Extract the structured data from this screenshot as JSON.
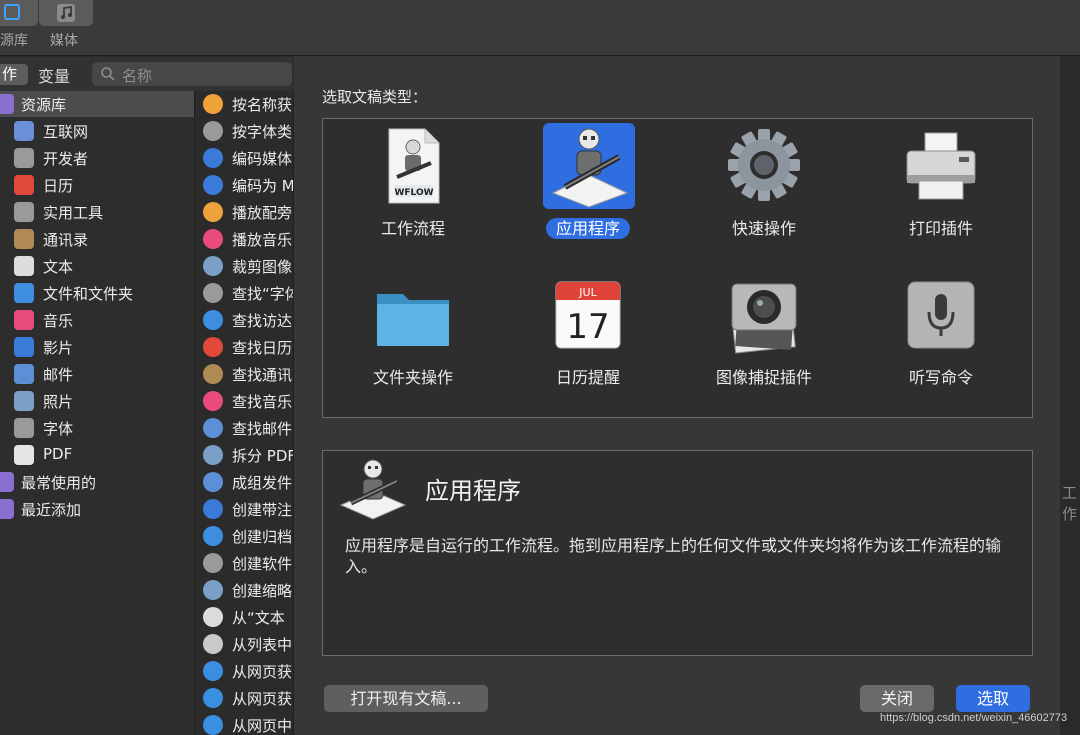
{
  "toolbar": {
    "library_label_fragment": "源库",
    "media_label": "媒体"
  },
  "tabs": {
    "actions_fragment": "作",
    "variables": "变量"
  },
  "search": {
    "placeholder": "名称"
  },
  "library": {
    "items": [
      {
        "label": "资源库",
        "icon": "library-icon",
        "color": "#8a6fd1"
      },
      {
        "label": "互联网",
        "icon": "internet-icon",
        "color": "#6b8fd8"
      },
      {
        "label": "开发者",
        "icon": "developer-tools-icon",
        "color": "#9a9a9a"
      },
      {
        "label": "日历",
        "icon": "calendar-icon",
        "color": "#e14a3b"
      },
      {
        "label": "实用工具",
        "icon": "utilities-icon",
        "color": "#9a9a9a"
      },
      {
        "label": "通讯录",
        "icon": "contacts-icon",
        "color": "#b08a55"
      },
      {
        "label": "文本",
        "icon": "text-icon",
        "color": "#dcdcdc"
      },
      {
        "label": "文件和文件夹",
        "icon": "finder-icon",
        "color": "#3d8de0"
      },
      {
        "label": "音乐",
        "icon": "music-icon",
        "color": "#e84c7a"
      },
      {
        "label": "影片",
        "icon": "movie-icon",
        "color": "#3a7ad8"
      },
      {
        "label": "邮件",
        "icon": "mail-icon",
        "color": "#5d8fd6"
      },
      {
        "label": "照片",
        "icon": "photos-icon",
        "color": "#7aa0c8"
      },
      {
        "label": "字体",
        "icon": "font-icon",
        "color": "#9a9a9a"
      },
      {
        "label": "PDF",
        "icon": "pdf-icon",
        "color": "#e6e6e6"
      },
      {
        "label": "最常使用的",
        "icon": "smart-folder-icon",
        "color": "#8a6fd1"
      },
      {
        "label": "最近添加",
        "icon": "smart-folder-icon",
        "color": "#8a6fd1"
      }
    ]
  },
  "actions": {
    "items": [
      {
        "label": "按名称获",
        "icon": "photos-icon",
        "color": "#f0a23a"
      },
      {
        "label": "按字体类",
        "icon": "font-icon",
        "color": "#9a9a9a"
      },
      {
        "label": "编码媒体",
        "icon": "movie-icon",
        "color": "#3a7ad8"
      },
      {
        "label": "编码为 M",
        "icon": "movie-icon",
        "color": "#3a7ad8"
      },
      {
        "label": "播放配旁",
        "icon": "photos-icon",
        "color": "#f0a23a"
      },
      {
        "label": "播放音乐",
        "icon": "music-icon",
        "color": "#e84c7a"
      },
      {
        "label": "裁剪图像",
        "icon": "preview-icon",
        "color": "#7aa0c8"
      },
      {
        "label": "查找“字体",
        "icon": "font-icon",
        "color": "#9a9a9a"
      },
      {
        "label": "查找访达",
        "icon": "finder-icon",
        "color": "#3d8de0"
      },
      {
        "label": "查找日历",
        "icon": "calendar-icon",
        "color": "#e14a3b"
      },
      {
        "label": "查找通讯",
        "icon": "contacts-icon",
        "color": "#b08a55"
      },
      {
        "label": "查找音乐",
        "icon": "music-icon",
        "color": "#e84c7a"
      },
      {
        "label": "查找邮件",
        "icon": "mail-icon",
        "color": "#5d8fd6"
      },
      {
        "label": "拆分 PDF",
        "icon": "preview-icon",
        "color": "#7aa0c8"
      },
      {
        "label": "成组发件",
        "icon": "mail-icon",
        "color": "#5d8fd6"
      },
      {
        "label": "创建带注",
        "icon": "movie-icon",
        "color": "#3a7ad8"
      },
      {
        "label": "创建归档",
        "icon": "finder-icon",
        "color": "#3d8de0"
      },
      {
        "label": "创建软件",
        "icon": "developer-tools-icon",
        "color": "#9a9a9a"
      },
      {
        "label": "创建缩略",
        "icon": "preview-icon",
        "color": "#7aa0c8"
      },
      {
        "label": "从“文本",
        "icon": "text-icon",
        "color": "#dcdcdc"
      },
      {
        "label": "从列表中",
        "icon": "automator-icon",
        "color": "#c9c9c9"
      },
      {
        "label": "从网页获",
        "icon": "safari-icon",
        "color": "#3a8fe0"
      },
      {
        "label": "从网页获",
        "icon": "safari-icon",
        "color": "#3a8fe0"
      },
      {
        "label": "从网页中",
        "icon": "safari-icon",
        "color": "#3a8fe0"
      }
    ]
  },
  "sheet": {
    "prompt": "选取文稿类型：",
    "types": [
      {
        "label": "工作流程",
        "icon": "workflow-file-icon"
      },
      {
        "label": "应用程序",
        "icon": "automator-robot-icon",
        "selected": true
      },
      {
        "label": "快速操作",
        "icon": "gear-icon"
      },
      {
        "label": "打印插件",
        "icon": "printer-icon"
      },
      {
        "label": "文件夹操作",
        "icon": "folder-icon"
      },
      {
        "label": "日历提醒",
        "icon": "calendar-icon"
      },
      {
        "label": "图像捕捉插件",
        "icon": "camera-icon"
      },
      {
        "label": "听写命令",
        "icon": "microphone-icon"
      }
    ],
    "workflow_badge": "WFLOW",
    "calendar_month": "JUL",
    "calendar_day": "17",
    "description": {
      "title": "应用程序",
      "text": "应用程序是自运行的工作流程。拖到应用程序上的任何文件或文件夹均将作为该工作流程的输入。"
    },
    "buttons": {
      "open_existing": "打开现有文稿...",
      "close": "关闭",
      "choose": "选取"
    }
  },
  "right_edge_fragment": "工作",
  "watermark": "https://blog.csdn.net/weixin_46602773",
  "colors": {
    "accent": "#2f6ee0"
  }
}
